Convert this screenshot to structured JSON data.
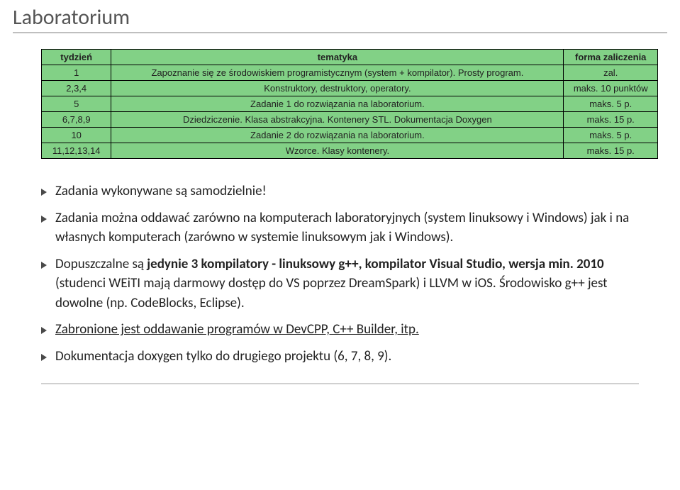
{
  "title": "Laboratorium",
  "table": {
    "headers": {
      "week": "tydzień",
      "topic": "tematyka",
      "form": "forma zaliczenia"
    },
    "rows": [
      {
        "week": "1",
        "topic": "Zapoznanie się ze środowiskiem programistycznym (system + kompilator). Prosty program.",
        "form": "zal."
      },
      {
        "week": "2,3,4",
        "topic": "Konstruktory, destruktory, operatory.",
        "form": "maks. 10 punktów"
      },
      {
        "week": "5",
        "topic": "Zadanie 1 do rozwiązania na laboratorium.",
        "form": "maks. 5 p."
      },
      {
        "week": "6,7,8,9",
        "topic": "Dziedziczenie. Klasa abstrakcyjna. Kontenery STL. Dokumentacja Doxygen",
        "form": "maks. 15 p."
      },
      {
        "week": "10",
        "topic": "Zadanie 2 do rozwiązania na laboratorium.",
        "form": "maks. 5 p."
      },
      {
        "week": "11,12,13,14",
        "topic": "Wzorce. Klasy kontenery.",
        "form": "maks. 15 p."
      }
    ]
  },
  "bullets": {
    "b1": "Zadania wykonywane są samodzielnie!",
    "b2": "Zadania można oddawać zarówno na komputerach laboratoryjnych (system linuksowy i Windows) jak i na własnych komputerach (zarówno w systemie linuksowym jak i Windows).",
    "b3_pre": "Dopuszczalne są ",
    "b3_bold": "jedynie 3 kompilatory - linuksowy g++, kompilator Visual Studio, wersja min. 2010",
    "b3_post": " (studenci WEiTI mają darmowy dostęp do VS poprzez DreamSpark) i LLVM w iOS. Środowisko g++ jest dowolne (np. CodeBlocks, Eclipse).",
    "b4": "Zabronione jest oddawanie programów w DevCPP, C++ Builder, itp.",
    "b5": "Dokumentacja doxygen tylko do drugiego projektu (6, 7, 8, 9)."
  }
}
